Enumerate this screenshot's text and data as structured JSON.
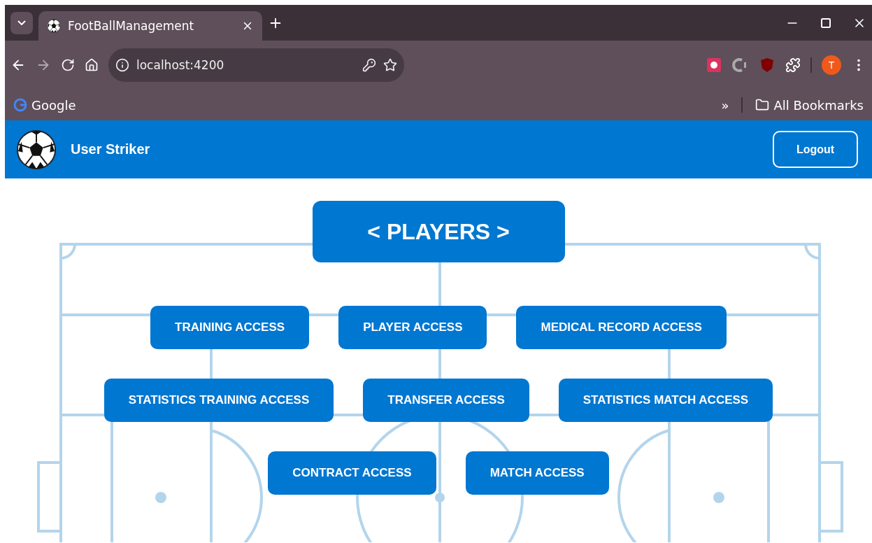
{
  "browser": {
    "tabs": [
      {
        "title": "FootBallManagement",
        "selected": true
      }
    ],
    "url": "localhost:4200",
    "profile_initial": "T",
    "bookmarks": [
      {
        "label": "Google"
      }
    ],
    "all_bookmarks": "All Bookmarks",
    "overflow": "»"
  },
  "header": {
    "user": "User Striker",
    "logout": "Logout"
  },
  "title": "< PLAYERS >",
  "rows": [
    [
      "TRAINING ACCESS",
      "PLAYER ACCESS",
      "MEDICAL RECORD ACCESS"
    ],
    [
      "STATISTICS TRAINING ACCESS",
      "TRANSFER ACCESS",
      "STATISTICS MATCH ACCESS"
    ],
    [
      "CONTRACT ACCESS",
      "MATCH ACCESS"
    ]
  ]
}
